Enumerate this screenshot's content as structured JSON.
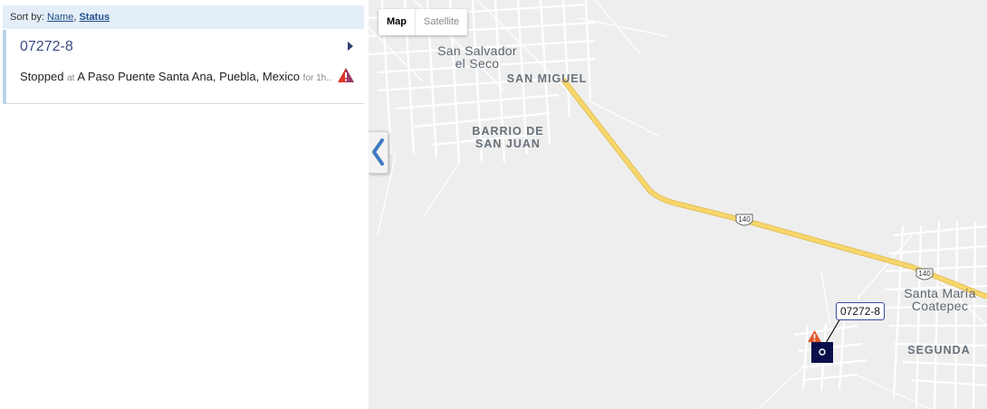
{
  "sort": {
    "prefix": "Sort by: ",
    "name_label": "Name",
    "separator": ", ",
    "status_label": "Status",
    "active": "Status"
  },
  "vehicles": [
    {
      "id": "07272-8",
      "status": "Stopped",
      "at_label": "at",
      "location": "A Paso Puente Santa Ana, Puebla, Mexico",
      "duration": "for 1h...",
      "alert_icon": "warning-triangle-icon",
      "alert_color": "#d9382a"
    }
  ],
  "map": {
    "type_buttons": [
      "Map",
      "Satellite"
    ],
    "active_type": "Map",
    "places": {
      "san_salvador_line1": "San Salvador",
      "san_salvador_line2": "el Seco",
      "san_miguel": "SAN MIGUEL",
      "barrio_line1": "BARRIO DE",
      "barrio_line2": "SAN JUAN",
      "santa_maria_line1": "Santa María",
      "santa_maria_line2": "Coatepec",
      "segunda": "SEGUNDA"
    },
    "highway_shields": [
      "140",
      "140"
    ],
    "marker_label": "07272-8",
    "colors": {
      "land": "#eeeeee",
      "street": "#ffffff",
      "highway": "#f7d66b",
      "marker": "#0a0f4c",
      "accent": "#1f4e8c"
    }
  }
}
